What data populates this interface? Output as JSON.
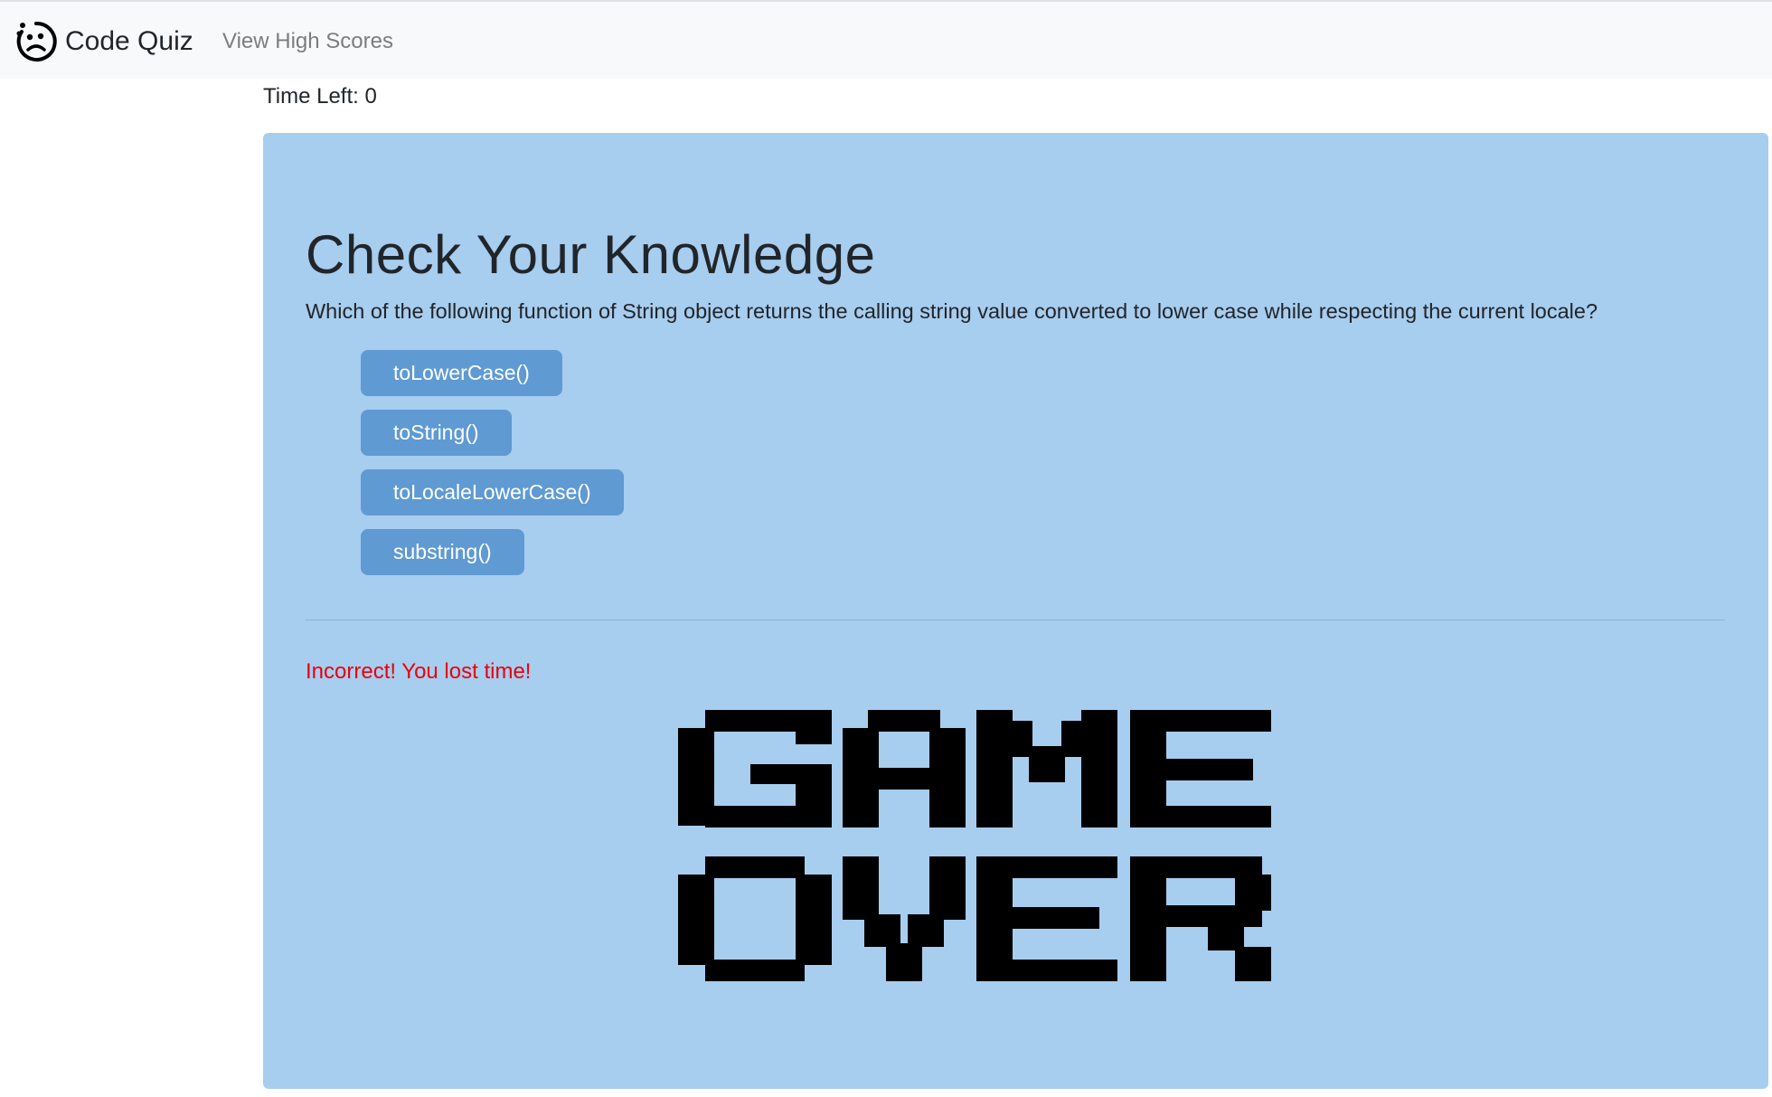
{
  "navbar": {
    "brand_icon": "sad-face-icon",
    "brand_text": "Code Quiz",
    "high_scores_link": "View High Scores"
  },
  "timer": {
    "text": "Time Left: 0"
  },
  "quiz": {
    "title": "Check Your Knowledge",
    "question": "Which of the following function of String object returns the calling string value converted to lower case while respecting the current locale?",
    "choices": [
      "toLowerCase()",
      "toString()",
      "toLocaleLowerCase()",
      "substring()"
    ],
    "feedback": "Incorrect! You lost time!",
    "game_over_image": "GAME OVER"
  },
  "colors": {
    "jumbotron_bg": "#a7cdef",
    "button_bg": "#5f9ad3",
    "navbar_bg": "#f8f9fa",
    "feedback_text": "#e8000b"
  }
}
